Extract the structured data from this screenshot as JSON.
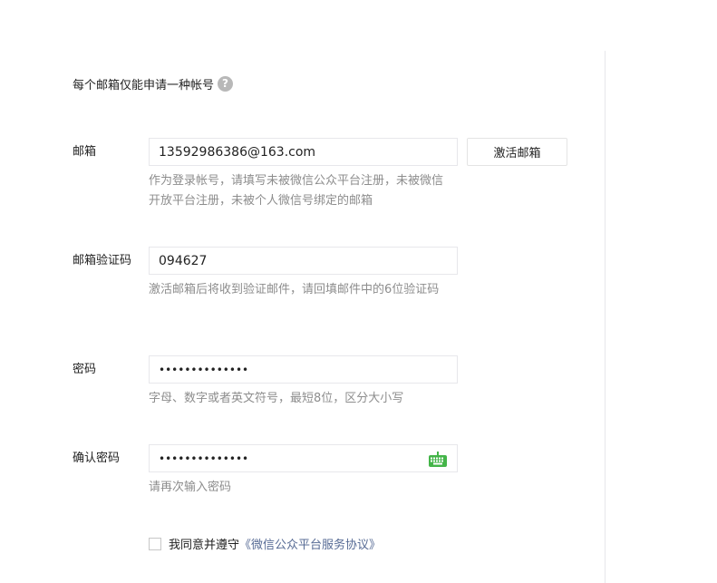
{
  "notice": {
    "text": "每个邮箱仅能申请一种帐号",
    "help_glyph": "?"
  },
  "email": {
    "label": "邮箱",
    "value": "13592986386@163.com",
    "activate_button": "激活邮箱",
    "tip": "作为登录帐号，请填写未被微信公众平台注册，未被微信开放平台注册，未被个人微信号绑定的邮箱"
  },
  "verify_code": {
    "label": "邮箱验证码",
    "value": "094627",
    "tip": "激活邮箱后将收到验证邮件，请回填邮件中的6位验证码"
  },
  "password": {
    "label": "密码",
    "value": "••••••••••••••",
    "tip": "字母、数字或者英文符号，最短8位，区分大小写"
  },
  "confirm_password": {
    "label": "确认密码",
    "value": "••••••••••••••",
    "tip": "请再次输入密码",
    "keyboard_icon": "keyboard-icon",
    "keyboard_color": "#44b549"
  },
  "agreement": {
    "prefix": "我同意并遵守",
    "link": "《微信公众平台服务协议》",
    "checked": false
  }
}
